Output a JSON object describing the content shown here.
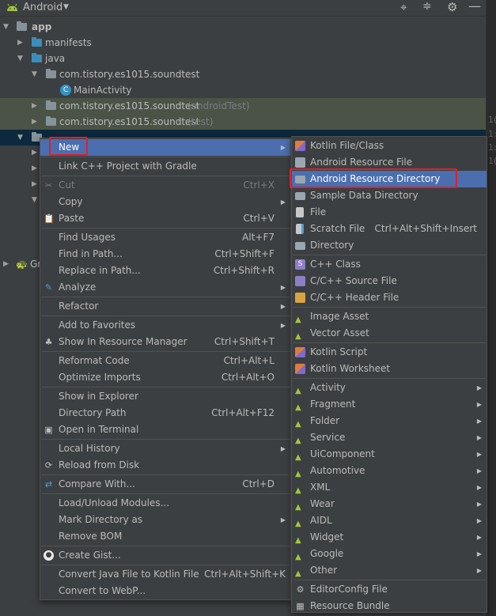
{
  "toolbar": {
    "title": "Android"
  },
  "tree": {
    "app": "app",
    "manifests": "manifests",
    "java": "java",
    "pkg_main": "com.tistory.es1015.soundtest",
    "main_activity": "MainActivity",
    "pkg_android_test": "com.tistory.es1015.soundtest",
    "pkg_android_test_suffix": "(androidTest)",
    "pkg_test": "com.tistory.es1015.soundtest",
    "pkg_test_suffix": "(test)",
    "gradle_fragment": "Gr"
  },
  "editor_gutter": [
    "1(",
    "1:",
    "1:",
    "1("
  ],
  "context_menu": {
    "items": [
      {
        "label": "New",
        "shortcut": "",
        "submenu": true
      },
      {
        "label": "Link C++ Project with Gradle",
        "shortcut": ""
      },
      {
        "label": "Cut",
        "shortcut": "Ctrl+X",
        "disabled": true
      },
      {
        "label": "Copy",
        "shortcut": "",
        "submenu": true
      },
      {
        "label": "Paste",
        "shortcut": "Ctrl+V"
      },
      {
        "label": "Find Usages",
        "shortcut": "Alt+F7"
      },
      {
        "label": "Find in Path...",
        "shortcut": "Ctrl+Shift+F"
      },
      {
        "label": "Replace in Path...",
        "shortcut": "Ctrl+Shift+R"
      },
      {
        "label": "Analyze",
        "shortcut": "",
        "submenu": true
      },
      {
        "label": "Refactor",
        "shortcut": "",
        "submenu": true
      },
      {
        "label": "Add to Favorites",
        "shortcut": "",
        "submenu": true
      },
      {
        "label": "Show In Resource Manager",
        "shortcut": "Ctrl+Shift+T"
      },
      {
        "label": "Reformat Code",
        "shortcut": "Ctrl+Alt+L"
      },
      {
        "label": "Optimize Imports",
        "shortcut": "Ctrl+Alt+O"
      },
      {
        "label": "Show in Explorer",
        "shortcut": ""
      },
      {
        "label": "Directory Path",
        "shortcut": "Ctrl+Alt+F12"
      },
      {
        "label": "Open in Terminal",
        "shortcut": ""
      },
      {
        "label": "Local History",
        "shortcut": "",
        "submenu": true
      },
      {
        "label": "Reload from Disk",
        "shortcut": ""
      },
      {
        "label": "Compare With...",
        "shortcut": "Ctrl+D"
      },
      {
        "label": "Load/Unload Modules...",
        "shortcut": ""
      },
      {
        "label": "Mark Directory as",
        "shortcut": "",
        "submenu": true
      },
      {
        "label": "Remove BOM",
        "shortcut": ""
      },
      {
        "label": "Create Gist...",
        "shortcut": ""
      },
      {
        "label": "Convert Java File to Kotlin File",
        "shortcut": "Ctrl+Alt+Shift+K"
      },
      {
        "label": "Convert to WebP...",
        "shortcut": ""
      }
    ]
  },
  "new_submenu": {
    "items": [
      {
        "label": "Kotlin File/Class",
        "shortcut": ""
      },
      {
        "label": "Android Resource File",
        "shortcut": ""
      },
      {
        "label": "Android Resource Directory",
        "shortcut": ""
      },
      {
        "label": "Sample Data Directory",
        "shortcut": ""
      },
      {
        "label": "File",
        "shortcut": ""
      },
      {
        "label": "Scratch File",
        "shortcut": "Ctrl+Alt+Shift+Insert"
      },
      {
        "label": "Directory",
        "shortcut": ""
      },
      {
        "label": "C++ Class",
        "shortcut": ""
      },
      {
        "label": "C/C++ Source File",
        "shortcut": ""
      },
      {
        "label": "C/C++ Header File",
        "shortcut": ""
      },
      {
        "label": "Image Asset",
        "shortcut": ""
      },
      {
        "label": "Vector Asset",
        "shortcut": ""
      },
      {
        "label": "Kotlin Script",
        "shortcut": ""
      },
      {
        "label": "Kotlin Worksheet",
        "shortcut": ""
      },
      {
        "label": "Activity",
        "shortcut": "",
        "submenu": true
      },
      {
        "label": "Fragment",
        "shortcut": "",
        "submenu": true
      },
      {
        "label": "Folder",
        "shortcut": "",
        "submenu": true
      },
      {
        "label": "Service",
        "shortcut": "",
        "submenu": true
      },
      {
        "label": "UiComponent",
        "shortcut": "",
        "submenu": true
      },
      {
        "label": "Automotive",
        "shortcut": "",
        "submenu": true
      },
      {
        "label": "XML",
        "shortcut": "",
        "submenu": true
      },
      {
        "label": "Wear",
        "shortcut": "",
        "submenu": true
      },
      {
        "label": "AIDL",
        "shortcut": "",
        "submenu": true
      },
      {
        "label": "Widget",
        "shortcut": "",
        "submenu": true
      },
      {
        "label": "Google",
        "shortcut": "",
        "submenu": true
      },
      {
        "label": "Other",
        "shortcut": "",
        "submenu": true
      },
      {
        "label": "EditorConfig File",
        "shortcut": ""
      },
      {
        "label": "Resource Bundle",
        "shortcut": ""
      }
    ]
  },
  "colors": {
    "selection": "#4b6eaf",
    "highlight_box": "#e0202a",
    "android_green": "#a4c639"
  }
}
